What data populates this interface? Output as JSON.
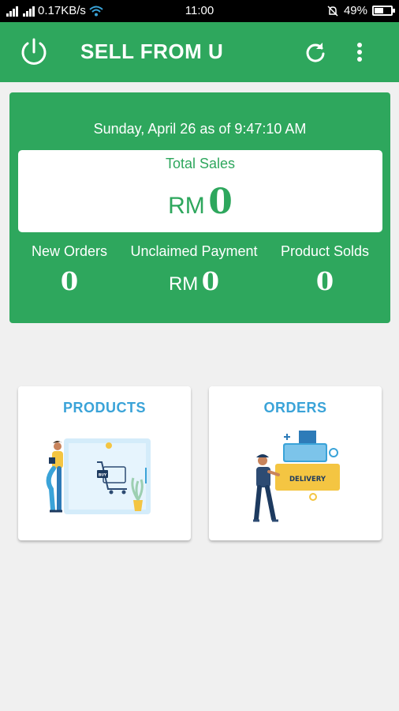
{
  "status_bar": {
    "net_speed": "0.17KB/s",
    "time": "11:00",
    "battery": "49%"
  },
  "app_bar": {
    "title": "SELL FROM U"
  },
  "summary": {
    "date_line": "Sunday, April 26 as of 9:47:10 AM",
    "total_sales_label": "Total Sales",
    "currency": "RM",
    "total_sales_value": "0",
    "stats": [
      {
        "label": "New Orders",
        "value": "0"
      },
      {
        "label": "Unclaimed Payment",
        "currency": "RM",
        "value": "0"
      },
      {
        "label": "Product Solds",
        "value": "0"
      }
    ]
  },
  "nav": {
    "products_label": "PRODUCTS",
    "orders_label": "ORDERS",
    "buy_badge": "BUY",
    "delivery_badge": "DELIVERY"
  },
  "colors": {
    "primary": "#2ea75d",
    "link": "#3aa3d8",
    "background": "#f0f0f0"
  },
  "icons": [
    "power-icon",
    "refresh-icon",
    "more-vert-icon",
    "wifi-icon",
    "signal-icon",
    "battery-icon",
    "alarm-icon"
  ]
}
